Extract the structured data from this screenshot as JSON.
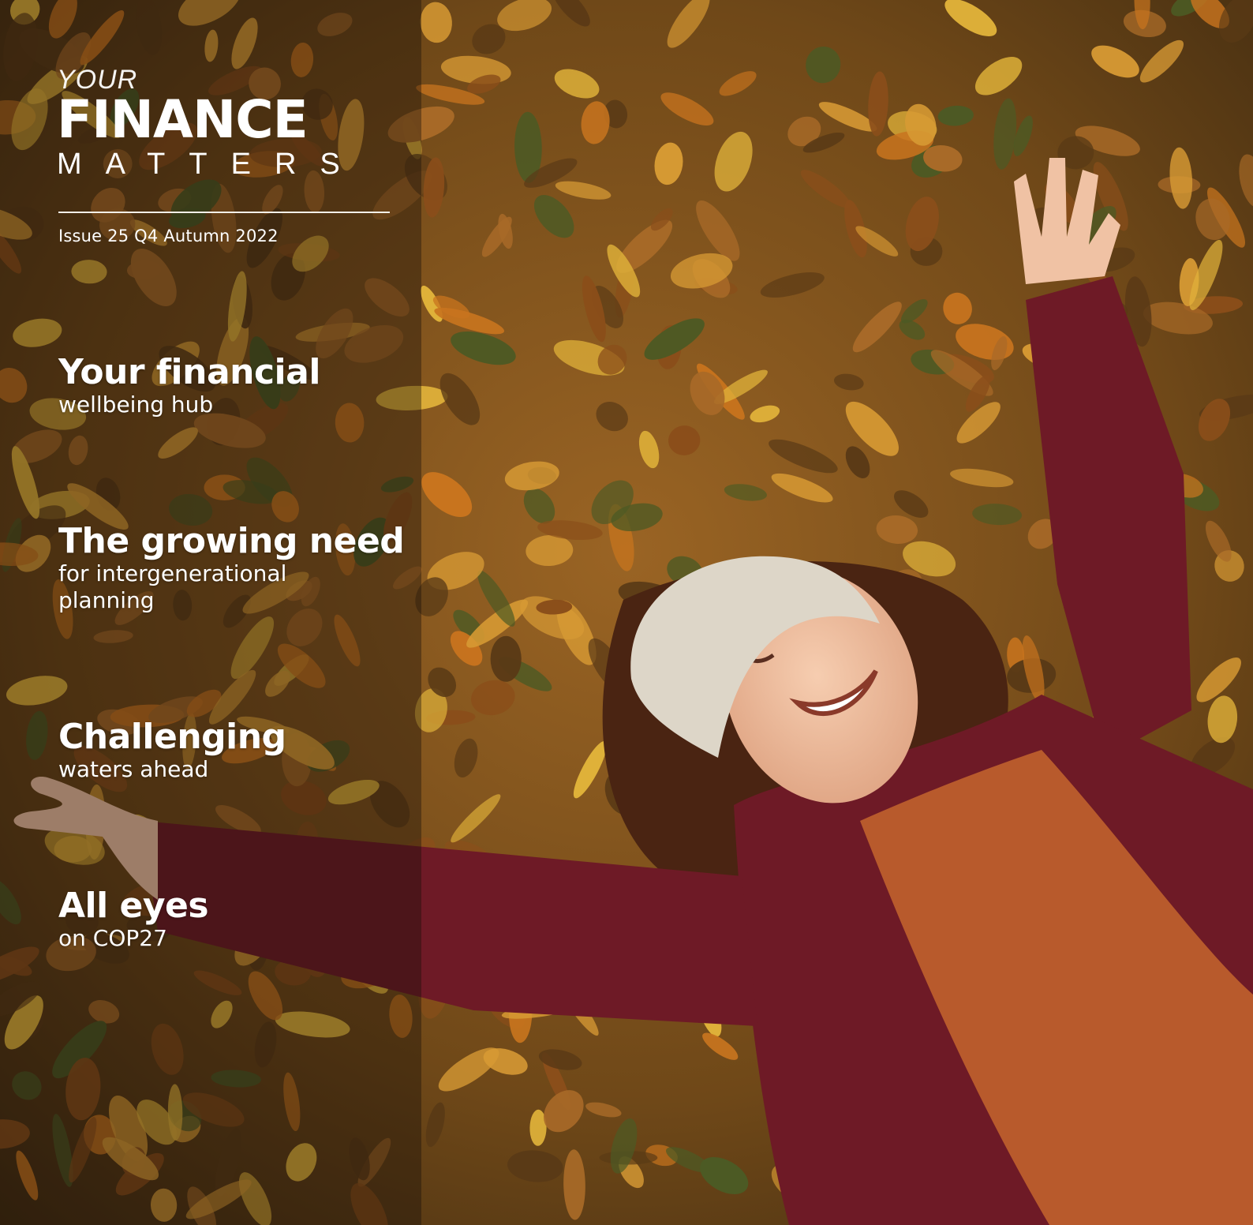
{
  "cover": {
    "masthead": {
      "line1": "YOUR",
      "line2": "FINANCE",
      "line3": "MATTERS"
    },
    "issue": "Issue 25 Q4 Autumn 2022",
    "stories": [
      {
        "headline": "Your financial",
        "subline": "wellbeing hub"
      },
      {
        "headline": "The growing need",
        "subline": "for intergenerational planning"
      },
      {
        "headline": "Challenging",
        "subline": "waters ahead"
      },
      {
        "headline": "All eyes",
        "subline": "on COP27"
      }
    ],
    "colors": {
      "leaf_dark": "#5a3a16",
      "leaf_orange": "#c8741e",
      "leaf_yellow": "#e0b23a",
      "jacket": "#6e1a26",
      "sweater": "#b85a2c",
      "hat": "#ddd6c8",
      "skin": "#f0c2a4"
    }
  }
}
